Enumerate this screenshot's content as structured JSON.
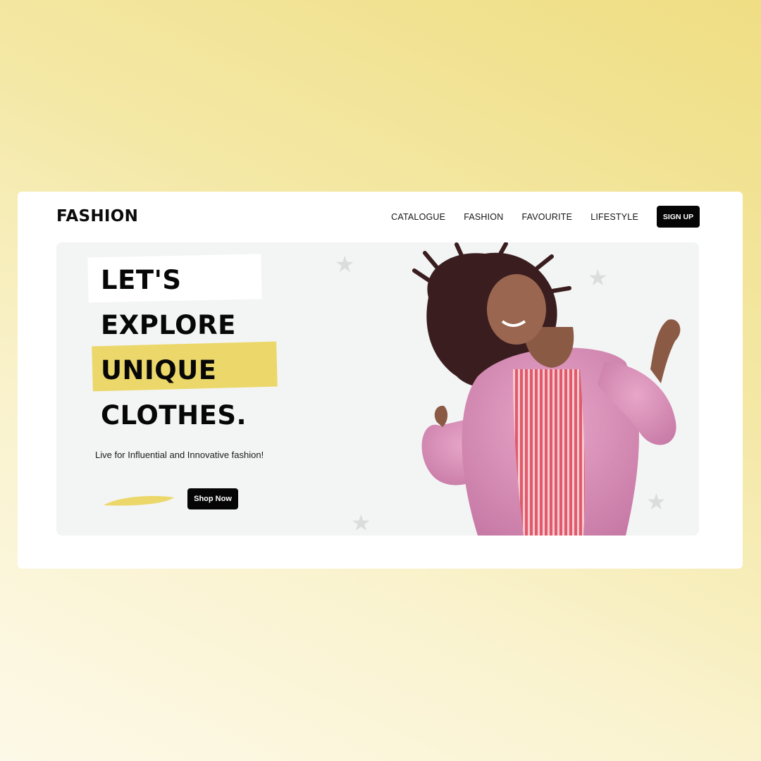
{
  "header": {
    "logo": "FASHION",
    "nav": [
      "CATALOGUE",
      "FASHION",
      "FAVOURITE",
      "LIFESTYLE"
    ],
    "signup_label": "SIGN UP"
  },
  "hero": {
    "headline": [
      "LET'S",
      "EXPLORE",
      "UNIQUE",
      "CLOTHES."
    ],
    "tagline": "Live for Influential and Innovative fashion!",
    "cta_label": "Shop Now"
  },
  "icons": {
    "decor": "star-icon"
  },
  "colors": {
    "accent": "#ecd86a",
    "dark": "#050505",
    "card": "#ffffff",
    "hero_bg": "#f3f4f4"
  }
}
